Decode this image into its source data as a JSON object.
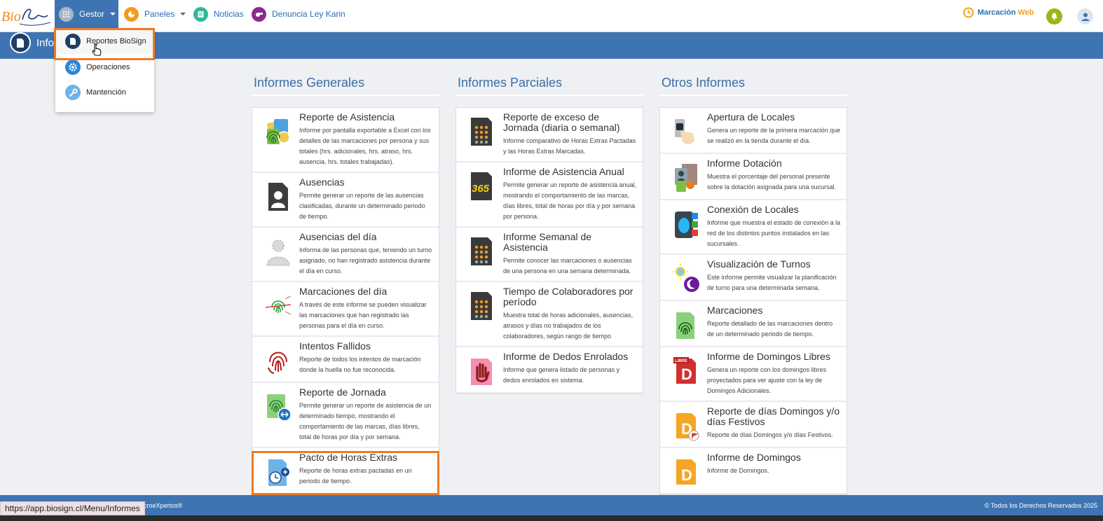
{
  "nav": {
    "logo_text": "BioSign",
    "items": [
      {
        "label": "Gestor",
        "icon": "apps-grid-icon"
      },
      {
        "label": "Paneles",
        "icon": "pie-chart-icon"
      },
      {
        "label": "Noticias",
        "icon": "news-icon"
      },
      {
        "label": "Denuncia Ley Karin",
        "icon": "whistle-icon"
      }
    ],
    "marcacion": "Marcación",
    "marcacion_web": "Web"
  },
  "header": {
    "title": "Informes"
  },
  "dropdown": {
    "items": [
      {
        "label": "Reportes BioSign",
        "icon": "document-icon"
      },
      {
        "label": "Operaciones",
        "icon": "gear-icon"
      },
      {
        "label": "Mantención",
        "icon": "wrench-icon"
      }
    ]
  },
  "columns": [
    {
      "title": "Informes Generales",
      "cards": [
        {
          "title": "Reporte de Asistencia",
          "desc": "Informe por pantalla exportable a Excel con los detalles de las marcaciones por persona y sus totales (hrs. adicionales, hrs. atraso, hrs. ausencia, hrs. totales trabajadas).",
          "icon": "attendance-report-icon"
        },
        {
          "title": "Ausencias",
          "desc": "Permite generar un reporte de las ausencias clasificadas, durante un determinado periodo de tiempo.",
          "icon": "absence-file-icon"
        },
        {
          "title": "Ausencias del día",
          "desc": "Informa de las personas que, teniendo un turno asignado, no han registrado asistencia durante el día en curso.",
          "icon": "absent-person-icon"
        },
        {
          "title": "Marcaciones del día",
          "desc": "A través de este informe se pueden visualizar las marcaciones que han registrado las personas para el día en curso.",
          "icon": "fingerprint-scan-icon"
        },
        {
          "title": "Intentos Fallidos",
          "desc": "Reporte de todos los intentos de marcación donde la huella no fue reconocida.",
          "icon": "failed-fingerprint-icon"
        },
        {
          "title": "Reporte de Jornada",
          "desc": "Permite generar un reporte de asistencia de un determinado tiempo, mostrando el comportamiento de las marcas, días libres, total de horas por día y por semana.",
          "icon": "workday-report-icon"
        },
        {
          "title": "Pacto de Horas Extras",
          "desc": "Reporte de horas extras pactadas en un periodo de tiempo.",
          "icon": "overtime-pact-icon"
        }
      ]
    },
    {
      "title": "Informes Parciales",
      "cards": [
        {
          "title": "Reporte de exceso de Jornada (diaria o semanal)",
          "desc": "Informe comparativo de Horas Extras Pactadas y las Horas Extras Marcadas.",
          "icon": "calculator-icon"
        },
        {
          "title": "Informe de Asistencia Anual",
          "desc": "Permite generar un reporte de asistencia anual, mostrando el comportamiento de las marcas, días libres, total de horas por día y por semana por persona.",
          "icon": "365-calendar-icon"
        },
        {
          "title": "Informe Semanal de Asistencia",
          "desc": "Permite conocer las marcaciones o ausencias de una persona en una semana determinada.",
          "icon": "weekly-calc-icon"
        },
        {
          "title": "Tiempo de Colaboradores por período",
          "desc": "Muestra total de horas adicionales, ausencias, atrasos y días no trabajados de los colaboradores, según rango de tiempo",
          "icon": "collaborator-time-icon"
        },
        {
          "title": "Informe de Dedos Enrolados",
          "desc": "Informe que genera listado de personas y dedos enrolados en sistema.",
          "icon": "enrolled-hand-icon"
        }
      ]
    },
    {
      "title": "Otros Informes",
      "cards": [
        {
          "title": "Apertura de Locales",
          "desc": "Genera un reporte de la primera marcación que se realizó en la tienda durante el día.",
          "icon": "store-opening-icon"
        },
        {
          "title": "Informe Dotación",
          "desc": "Muestra el porcentaje del personal presente sobre la dotación asignada para una sucursal.",
          "icon": "staffing-icon"
        },
        {
          "title": "Conexión de Locales",
          "desc": "Informe que muestra el estado de conexión a la red de los distintos puntos instalados en las sucursales.",
          "icon": "store-connection-icon"
        },
        {
          "title": "Visualización de Turnos",
          "desc": "Este informe permite visualizar la planificación de turno para una determinada semana.",
          "icon": "sun-moon-icon"
        },
        {
          "title": "Marcaciones",
          "desc": "Reporte detallado de las marcaciones dentro de un determinado periodo de tiempo.",
          "icon": "marcaciones-fingerprint-icon"
        },
        {
          "title": "Informe de Domingos Libres",
          "desc": "Genera un reporte con los domingos libres proyectados para ver ajuste con la ley de Domingos Adicionales.",
          "icon": "libre-d-icon"
        },
        {
          "title": "Reporte de días Domingos y/o días Festivos",
          "desc": "Reporte de días Domingos y/o días Festivos.",
          "icon": "holiday-d-icon"
        },
        {
          "title": "Informe de Domingos",
          "desc": "Informe de Domingos.",
          "icon": "sunday-d-icon"
        }
      ]
    }
  ],
  "footer": {
    "left": "croeXpertos®",
    "right": "© Todos los Derechos Reservados 2025"
  },
  "status_url": "https://app.biosign.cl/Menu/Informes"
}
